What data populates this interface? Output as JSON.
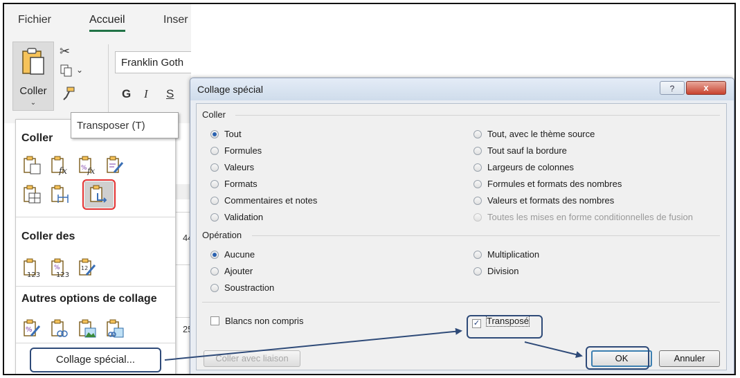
{
  "ribbon": {
    "tabs": [
      "Fichier",
      "Accueil",
      "Inser"
    ],
    "paste_label": "Coller",
    "font_name": "Franklin Goth",
    "format_buttons": [
      "G",
      "I",
      "S"
    ],
    "bg_numbers": [
      "44",
      "25"
    ]
  },
  "paste_menu": {
    "section_coller": "Coller",
    "section_coller_des": "Coller des",
    "section_autres": "Autres options de collage",
    "tooltip": "Transposer (T)",
    "collage_special": "Collage spécial..."
  },
  "dialog": {
    "title": "Collage spécial",
    "help": "?",
    "close": "x",
    "coller_label": "Coller",
    "operation_label": "Opération",
    "coller_left": [
      {
        "label": "Tout",
        "selected": true
      },
      {
        "label": "Formules",
        "selected": false
      },
      {
        "label": "Valeurs",
        "selected": false
      },
      {
        "label": "Formats",
        "selected": false
      },
      {
        "label": "Commentaires et notes",
        "selected": false
      },
      {
        "label": "Validation",
        "selected": false
      }
    ],
    "coller_right": [
      {
        "label": "Tout, avec le thème source",
        "enabled": true
      },
      {
        "label": "Tout sauf la bordure",
        "enabled": true
      },
      {
        "label": "Largeurs de colonnes",
        "enabled": true
      },
      {
        "label": "Formules et formats des nombres",
        "enabled": true
      },
      {
        "label": "Valeurs et formats des nombres",
        "enabled": true
      },
      {
        "label": "Toutes les mises en forme conditionnelles de fusion",
        "enabled": false
      }
    ],
    "operation_left": [
      {
        "label": "Aucune",
        "selected": true
      },
      {
        "label": "Ajouter",
        "selected": false
      },
      {
        "label": "Soustraction",
        "selected": false
      }
    ],
    "operation_right": [
      {
        "label": "Multiplication",
        "selected": false
      },
      {
        "label": "Division",
        "selected": false
      }
    ],
    "skip_blanks": {
      "label": "Blancs non compris",
      "checked": false
    },
    "transpose": {
      "label": "Transposé",
      "checked": true,
      "mark": "✓"
    },
    "paste_link": "Coller avec liaison",
    "ok": "OK",
    "cancel": "Annuler"
  },
  "colors": {
    "accent_green": "#217346",
    "highlight_red": "#e23030",
    "annotation_blue": "#2e4a78"
  }
}
